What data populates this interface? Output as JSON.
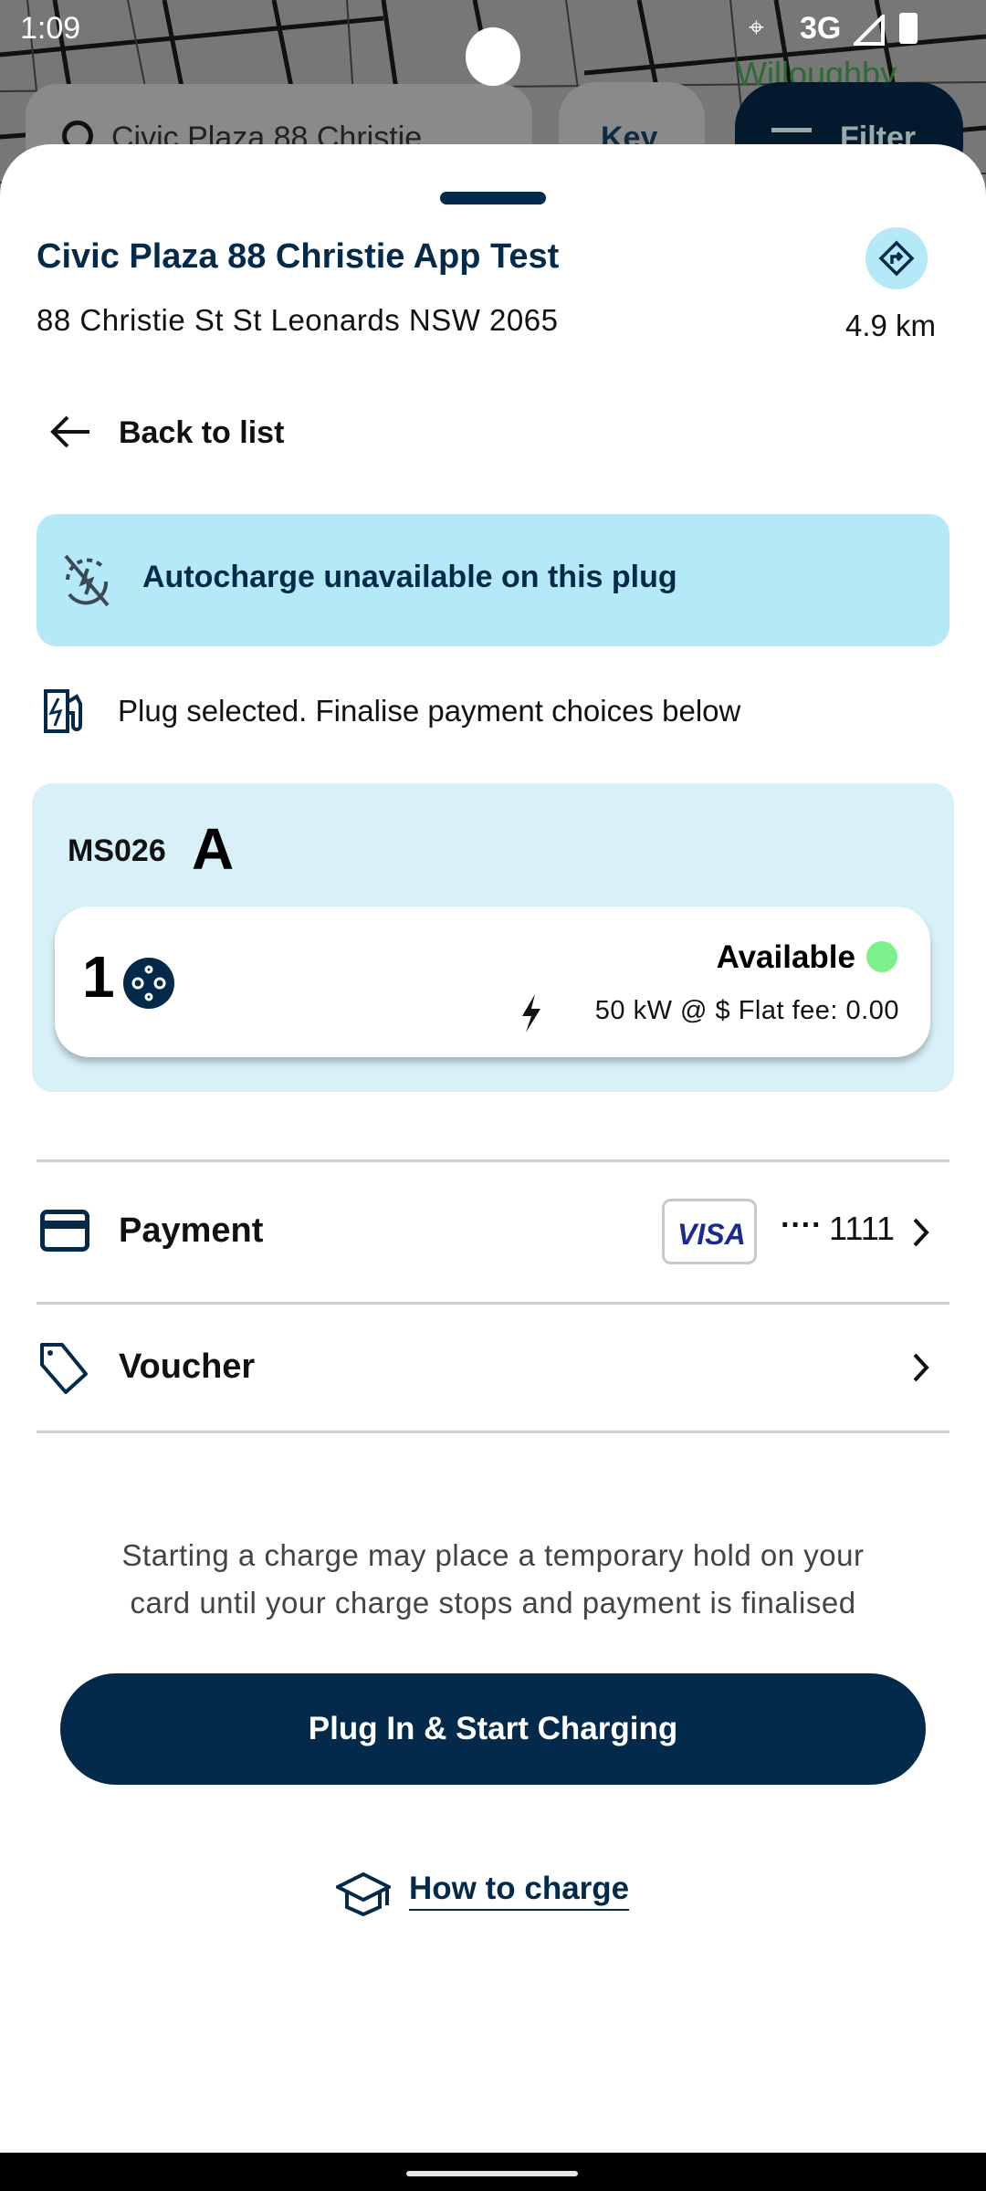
{
  "status_bar": {
    "time": "1:09",
    "network": "3G"
  },
  "map": {
    "search_text": "Civic Plaza 88 Christie",
    "key_label": "Key",
    "filter_label": "Filter",
    "place_label": "Willoughby"
  },
  "station": {
    "title": "Civic Plaza 88 Christie App Test",
    "address": "88 Christie St St Leonards NSW 2065",
    "distance": "4.9 km"
  },
  "back_label": "Back to list",
  "autocharge_notice": "Autocharge unavailable on this plug",
  "plug_selected_text": "Plug selected. Finalise payment choices below",
  "charger": {
    "id": "MS026",
    "letter": "A",
    "plug_number": "1",
    "status": "Available",
    "status_color": "#7cf08a",
    "rate": "50 kW @ $ Flat fee: 0.00"
  },
  "payment": {
    "label": "Payment",
    "card_brand": "VISA",
    "card_mask": "····",
    "card_last4": "1111"
  },
  "voucher": {
    "label": "Voucher"
  },
  "disclaimer_line1": "Starting a charge may place a temporary hold on your",
  "disclaimer_line2": "card until your charge stops and payment is finalised",
  "start_button": "Plug In & Start Charging",
  "how_to_charge": "How to charge",
  "colors": {
    "navy": "#032a4a",
    "notice_bg": "#b4e9f7",
    "charger_bg": "#d8f1f8"
  }
}
